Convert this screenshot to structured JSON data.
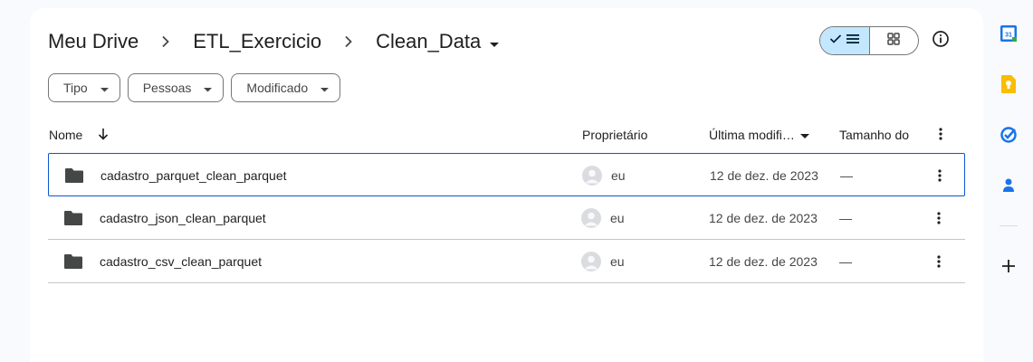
{
  "breadcrumb": {
    "items": [
      "Meu Drive",
      "ETL_Exercicio",
      "Clean_Data"
    ],
    "separator_icon": "chevron-right-icon"
  },
  "toolbar": {
    "view_mode": "list",
    "list_view_icon": "check-list-icon",
    "grid_view_icon": "grid-icon",
    "info_icon": "info-icon"
  },
  "filters": [
    {
      "label": "Tipo"
    },
    {
      "label": "Pessoas"
    },
    {
      "label": "Modificado"
    }
  ],
  "table": {
    "columns": {
      "name": "Nome",
      "owner": "Proprietário",
      "modified": "Última modifi…",
      "size": "Tamanho do"
    },
    "sort_icon": "arrow-down-icon",
    "rows": [
      {
        "name": "cadastro_parquet_clean_parquet",
        "owner": "eu",
        "modified": "12 de dez. de 2023",
        "size": "—",
        "selected": true
      },
      {
        "name": "cadastro_json_clean_parquet",
        "owner": "eu",
        "modified": "12 de dez. de 2023",
        "size": "—",
        "selected": false
      },
      {
        "name": "cadastro_csv_clean_parquet",
        "owner": "eu",
        "modified": "12 de dez. de 2023",
        "size": "—",
        "selected": false
      }
    ]
  },
  "side_panel": {
    "apps": [
      "calendar-icon",
      "keep-icon",
      "tasks-icon",
      "contacts-icon"
    ],
    "calendar_day": "31",
    "add_icon": "plus-icon"
  },
  "colors": {
    "accent": "#0b57d0",
    "selected_toggle": "#c2e7ff",
    "folder": "#444746",
    "calendar_blue": "#1a73e8",
    "calendar_green": "#34a853",
    "keep_yellow": "#fbbc04",
    "tasks_blue": "#1a73e8"
  }
}
